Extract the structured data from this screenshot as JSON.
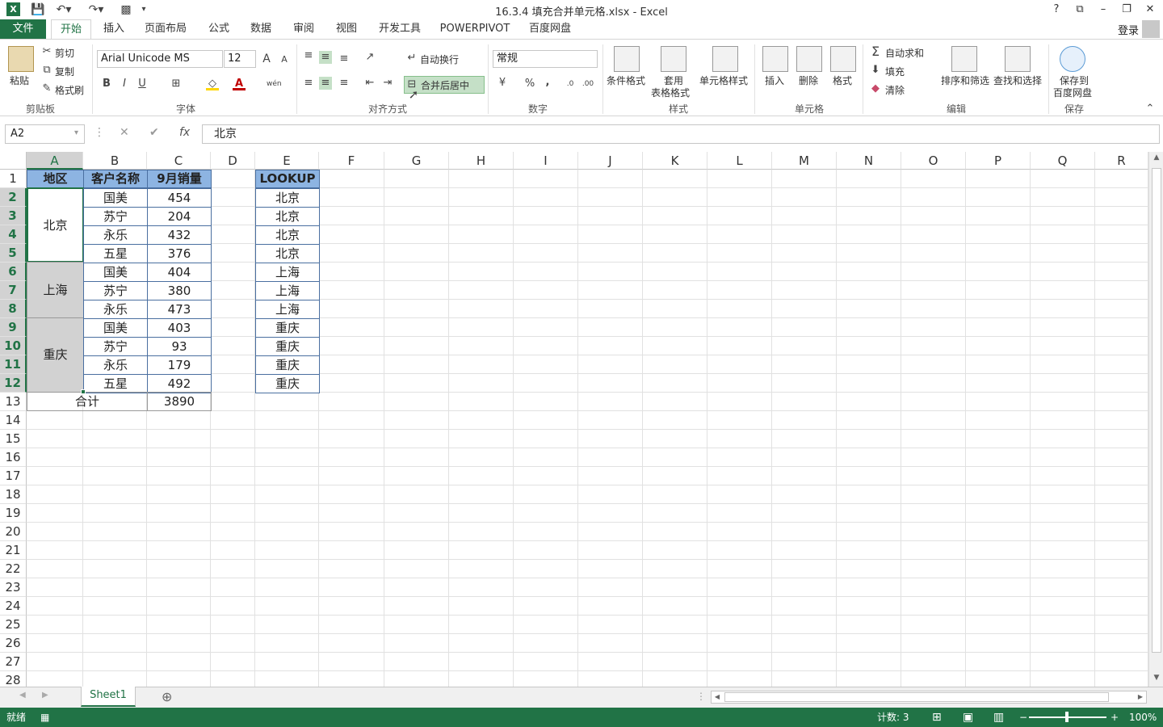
{
  "app": {
    "title": "16.3.4 填充合并单元格.xlsx - Excel",
    "logo": "X",
    "qat_icons": [
      "save-icon",
      "undo-icon",
      "redo-icon",
      "camera-icon",
      "customize-icon"
    ],
    "window_controls": [
      "?",
      "⧉",
      "–",
      "❐",
      "✕"
    ],
    "login": "登录"
  },
  "tabs": [
    "文件",
    "开始",
    "插入",
    "页面布局",
    "公式",
    "数据",
    "审阅",
    "视图",
    "开发工具",
    "POWERPIVOT",
    "百度网盘"
  ],
  "active_tab": "开始",
  "ribbon": {
    "clipboard": {
      "paste": "粘贴",
      "cut": "剪切",
      "copy": "复制",
      "format_painter": "格式刷",
      "label": "剪贴板"
    },
    "font": {
      "name": "Arial Unicode MS",
      "size": "12",
      "grow": "A",
      "shrink": "A",
      "bold": "B",
      "italic": "I",
      "underline": "U",
      "label": "字体",
      "phonetic": "wén"
    },
    "alignment": {
      "wrap": "自动换行",
      "merge": "合并后居中",
      "label": "对齐方式"
    },
    "number": {
      "format": "常规",
      "percent": "%",
      "comma": ",",
      "label": "数字"
    },
    "styles": {
      "conditional": "条件格式",
      "table_line1": "套用",
      "table_line2": "表格格式",
      "cell_styles": "单元格样式",
      "label": "样式"
    },
    "cells": {
      "insert": "插入",
      "delete": "删除",
      "format": "格式",
      "label": "单元格"
    },
    "editing": {
      "autosum": "自动求和",
      "fill": "填充",
      "clear": "清除",
      "sort": "排序和筛选",
      "find": "查找和选择",
      "label": "编辑"
    },
    "save": {
      "line1": "保存到",
      "line2": "百度网盘",
      "label": "保存"
    }
  },
  "formula_bar": {
    "name_box": "A2",
    "cancel": "✕",
    "enter": "✔",
    "fx": "fx",
    "value": "北京"
  },
  "columns": [
    "A",
    "B",
    "C",
    "D",
    "E",
    "F",
    "G",
    "H",
    "I",
    "J",
    "K",
    "L",
    "M",
    "N",
    "O",
    "P",
    "Q",
    "R"
  ],
  "rows": [
    "1",
    "2",
    "3",
    "4",
    "5",
    "6",
    "7",
    "8",
    "9",
    "10",
    "11",
    "12",
    "13",
    "14",
    "15",
    "16",
    "17",
    "18",
    "19",
    "20",
    "21",
    "22",
    "23",
    "24",
    "25",
    "26",
    "27",
    "28"
  ],
  "sheet": {
    "header": {
      "a": "地区",
      "b": "客户名称",
      "c": "9月销量",
      "e": "LOOKUP"
    },
    "regions": [
      "北京",
      "上海",
      "重庆"
    ],
    "customers": [
      "国美",
      "苏宁",
      "永乐",
      "五星",
      "国美",
      "苏宁",
      "永乐",
      "国美",
      "苏宁",
      "永乐",
      "五星"
    ],
    "sales": [
      "454",
      "204",
      "432",
      "376",
      "404",
      "380",
      "473",
      "403",
      "93",
      "179",
      "492"
    ],
    "lookup": [
      "北京",
      "北京",
      "北京",
      "北京",
      "上海",
      "上海",
      "上海",
      "重庆",
      "重庆",
      "重庆",
      "重庆"
    ],
    "total_label": "合计",
    "total_value": "3890"
  },
  "sheet_tabs": {
    "active": "Sheet1",
    "add": "⊕"
  },
  "status": {
    "ready": "就绪",
    "count": "计数: 3",
    "zoom": "100%",
    "minus": "−",
    "plus": "+"
  }
}
